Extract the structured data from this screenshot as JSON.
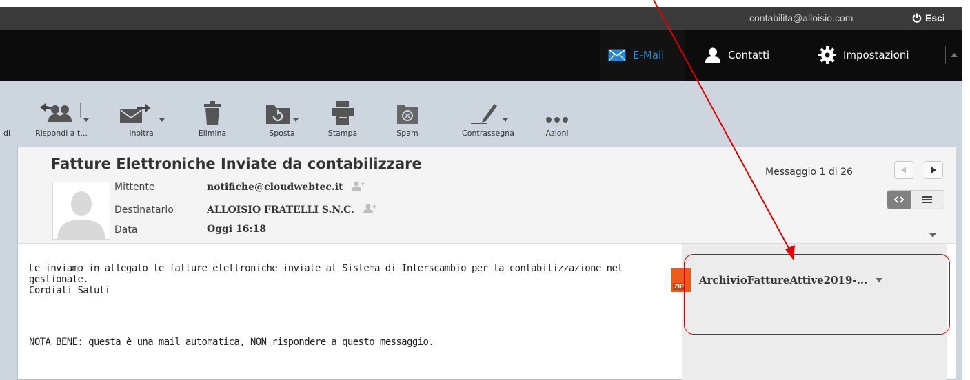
{
  "topbar": {
    "account_email": "contabilita@alloisio.com",
    "logout_label": "Esci"
  },
  "nav": {
    "email_label": "E-Mail",
    "contacts_label": "Contatti",
    "settings_label": "Impostazioni",
    "active_color": "#2a86d6"
  },
  "toolbar": {
    "partial_label": "di",
    "reply_all_label": "Rispondi a t...",
    "forward_label": "Inoltra",
    "delete_label": "Elimina",
    "move_label": "Sposta",
    "print_label": "Stampa",
    "spam_label": "Spam",
    "flag_label": "Contrassegna",
    "actions_label": "Azioni"
  },
  "message": {
    "subject": "Fatture Elettroniche Inviate da contabilizzare",
    "sender_label": "Mittente",
    "sender_value": "notifiche@cloudwebtec.it",
    "recipient_label": "Destinatario",
    "recipient_value": "ALLOISIO FRATELLI S.N.C.",
    "date_label": "Data",
    "date_value": "Oggi 16:18",
    "counter": "Messaggio 1 di 26",
    "body_line1": "Le inviamo in allegato le fatture elettroniche inviate al Sistema di Interscambio per la contabilizzazione nel",
    "body_line2": "gestionale.",
    "body_line3": "Cordiali Saluti",
    "body_note": "NOTA BENE: questa è una mail automatica, NON rispondere a questo messaggio."
  },
  "attachment": {
    "badge": "ZIP",
    "filename": "ArchivioFattureAttive2019-..."
  },
  "annotation": {
    "color": "#e00000"
  }
}
